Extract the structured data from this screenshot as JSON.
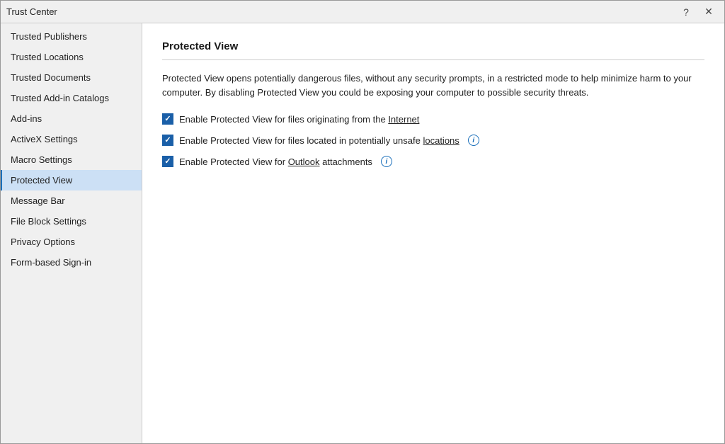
{
  "window": {
    "title": "Trust Center",
    "help_btn": "?",
    "close_btn": "✕"
  },
  "sidebar": {
    "items": [
      {
        "id": "trusted-publishers",
        "label": "Trusted Publishers",
        "active": false
      },
      {
        "id": "trusted-locations",
        "label": "Trusted Locations",
        "active": false
      },
      {
        "id": "trusted-documents",
        "label": "Trusted Documents",
        "active": false
      },
      {
        "id": "trusted-add-in-catalogs",
        "label": "Trusted Add-in Catalogs",
        "active": false
      },
      {
        "id": "add-ins",
        "label": "Add-ins",
        "active": false
      },
      {
        "id": "activex-settings",
        "label": "ActiveX Settings",
        "active": false
      },
      {
        "id": "macro-settings",
        "label": "Macro Settings",
        "active": false
      },
      {
        "id": "protected-view",
        "label": "Protected View",
        "active": true
      },
      {
        "id": "message-bar",
        "label": "Message Bar",
        "active": false
      },
      {
        "id": "file-block-settings",
        "label": "File Block Settings",
        "active": false
      },
      {
        "id": "privacy-options",
        "label": "Privacy Options",
        "active": false
      },
      {
        "id": "form-based-sign-in",
        "label": "Form-based Sign-in",
        "active": false
      }
    ]
  },
  "content": {
    "title": "Protected View",
    "description": "Protected View opens potentially dangerous files, without any security prompts, in a restricted mode to help minimize harm to your computer. By disabling Protected View you could be exposing your computer to possible security threats.",
    "checkboxes": [
      {
        "id": "internet-files",
        "label": "Enable Protected View for files originating from the Internet",
        "underline_word": "Internet",
        "checked": true,
        "has_info": false
      },
      {
        "id": "unsafe-locations",
        "label": "Enable Protected View for files located in potentially unsafe locations",
        "underline_word": "locations",
        "checked": true,
        "has_info": true
      },
      {
        "id": "outlook-attachments",
        "label": "Enable Protected View for Outlook attachments",
        "underline_word": "Outlook",
        "checked": true,
        "has_info": true
      }
    ]
  }
}
